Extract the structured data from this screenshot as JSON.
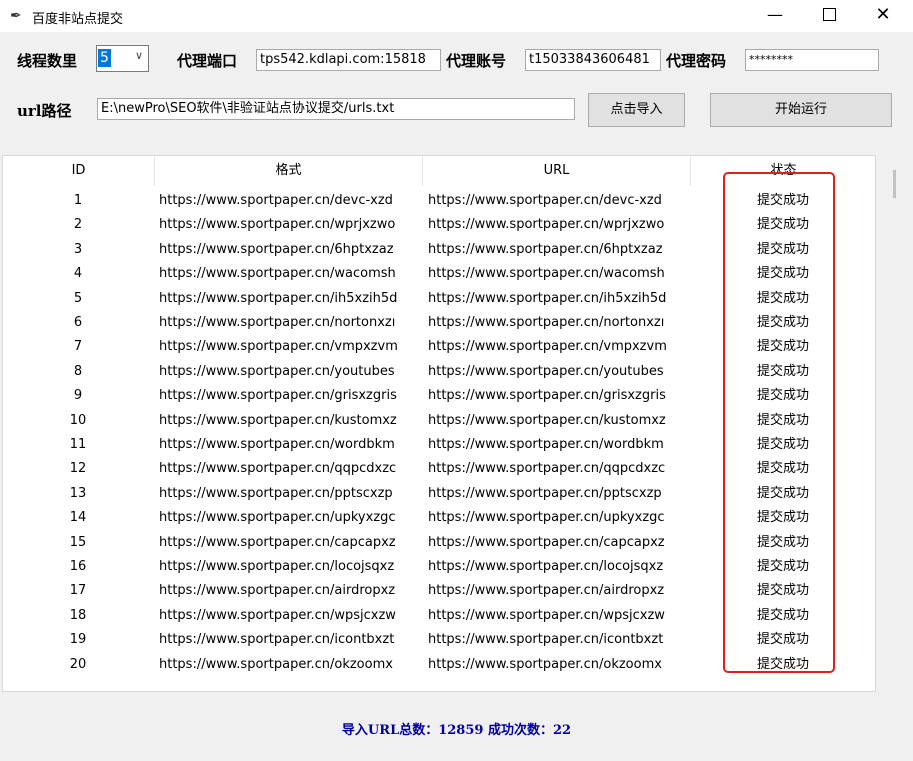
{
  "window": {
    "title": "百度非站点提交",
    "icon": "feather-icon",
    "controls": {
      "minimize": "—",
      "close": "✕"
    }
  },
  "form": {
    "threads": {
      "label": "线程数里",
      "value": "5"
    },
    "proxy_port": {
      "label": "代理端口",
      "value": "tps542.kdlapi.com:15818"
    },
    "proxy_account": {
      "label": "代理账号",
      "value": "t15033843606481"
    },
    "proxy_password": {
      "label": "代理密码",
      "value": "********"
    },
    "url_path": {
      "label": "url路径",
      "value": "E:\\newPro\\SEO软件\\非验证站点协议提交/urls.txt"
    },
    "import_button": "点击导入",
    "start_button": "开始运行"
  },
  "table": {
    "headers": [
      "ID",
      "格式",
      "URL",
      "状态"
    ],
    "rows": [
      {
        "id": "1",
        "fmt": "https://www.sportpaper.cn/devc-xzd",
        "url": "https://www.sportpaper.cn/devc-xzd",
        "status": "提交成功"
      },
      {
        "id": "2",
        "fmt": "https://www.sportpaper.cn/wprjxzwo",
        "url": "https://www.sportpaper.cn/wprjxzwo",
        "status": "提交成功"
      },
      {
        "id": "3",
        "fmt": "https://www.sportpaper.cn/6hptxzaz",
        "url": "https://www.sportpaper.cn/6hptxzaz",
        "status": "提交成功"
      },
      {
        "id": "4",
        "fmt": "https://www.sportpaper.cn/wacomsh",
        "url": "https://www.sportpaper.cn/wacomsh",
        "status": "提交成功"
      },
      {
        "id": "5",
        "fmt": "https://www.sportpaper.cn/ih5xzih5d",
        "url": "https://www.sportpaper.cn/ih5xzih5d",
        "status": "提交成功"
      },
      {
        "id": "6",
        "fmt": "https://www.sportpaper.cn/nortonxzı",
        "url": "https://www.sportpaper.cn/nortonxzı",
        "status": "提交成功"
      },
      {
        "id": "7",
        "fmt": "https://www.sportpaper.cn/vmpxzvm",
        "url": "https://www.sportpaper.cn/vmpxzvm",
        "status": "提交成功"
      },
      {
        "id": "8",
        "fmt": "https://www.sportpaper.cn/youtubes",
        "url": "https://www.sportpaper.cn/youtubes",
        "status": "提交成功"
      },
      {
        "id": "9",
        "fmt": "https://www.sportpaper.cn/grisxzgris",
        "url": "https://www.sportpaper.cn/grisxzgris",
        "status": "提交成功"
      },
      {
        "id": "10",
        "fmt": "https://www.sportpaper.cn/kustomxz",
        "url": "https://www.sportpaper.cn/kustomxz",
        "status": "提交成功"
      },
      {
        "id": "11",
        "fmt": "https://www.sportpaper.cn/wordbkm",
        "url": "https://www.sportpaper.cn/wordbkm",
        "status": "提交成功"
      },
      {
        "id": "12",
        "fmt": "https://www.sportpaper.cn/qqpcdxzc",
        "url": "https://www.sportpaper.cn/qqpcdxzc",
        "status": "提交成功"
      },
      {
        "id": "13",
        "fmt": "https://www.sportpaper.cn/pptscxzp",
        "url": "https://www.sportpaper.cn/pptscxzp",
        "status": "提交成功"
      },
      {
        "id": "14",
        "fmt": "https://www.sportpaper.cn/upkyxzgc",
        "url": "https://www.sportpaper.cn/upkyxzgc",
        "status": "提交成功"
      },
      {
        "id": "15",
        "fmt": "https://www.sportpaper.cn/capcapxz",
        "url": "https://www.sportpaper.cn/capcapxz",
        "status": "提交成功"
      },
      {
        "id": "16",
        "fmt": "https://www.sportpaper.cn/locojsqxz",
        "url": "https://www.sportpaper.cn/locojsqxz",
        "status": "提交成功"
      },
      {
        "id": "17",
        "fmt": "https://www.sportpaper.cn/airdropxz",
        "url": "https://www.sportpaper.cn/airdropxz",
        "status": "提交成功"
      },
      {
        "id": "18",
        "fmt": "https://www.sportpaper.cn/wpsjcxzw",
        "url": "https://www.sportpaper.cn/wpsjcxzw",
        "status": "提交成功"
      },
      {
        "id": "19",
        "fmt": "https://www.sportpaper.cn/icontbxzt",
        "url": "https://www.sportpaper.cn/icontbxzt",
        "status": "提交成功"
      },
      {
        "id": "20",
        "fmt": "https://www.sportpaper.cn/okzoomx",
        "url": "https://www.sportpaper.cn/okzoomx",
        "status": "提交成功"
      }
    ]
  },
  "status_bar": "导入URL总数：12859 成功次数：22",
  "colors": {
    "highlight_box": "#e02020",
    "status_text": "#0000a0",
    "selection": "#0078d7"
  }
}
